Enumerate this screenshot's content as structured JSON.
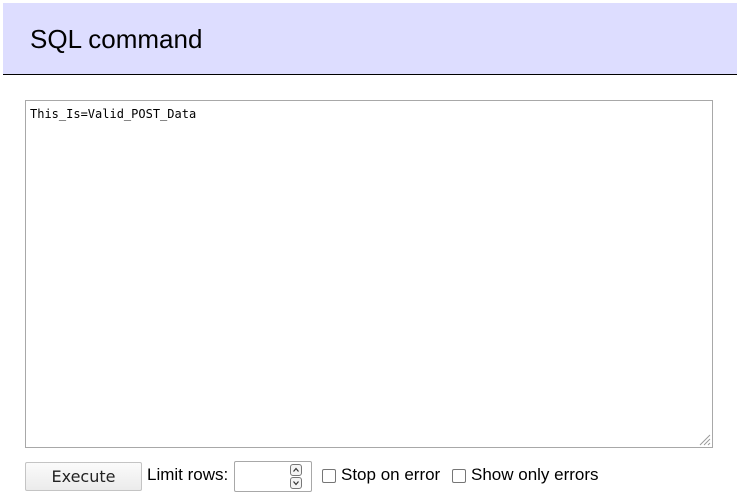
{
  "header": {
    "title": "SQL command"
  },
  "editor": {
    "value": "This_Is=Valid_POST_Data"
  },
  "controls": {
    "execute_label": "Execute",
    "limit_label": "Limit rows:",
    "limit_value": "",
    "stop_on_error_label": "Stop on error",
    "show_only_errors_label": "Show only errors"
  },
  "colors": {
    "header_bg": "#ddddff",
    "border": "#a8a8a8"
  }
}
